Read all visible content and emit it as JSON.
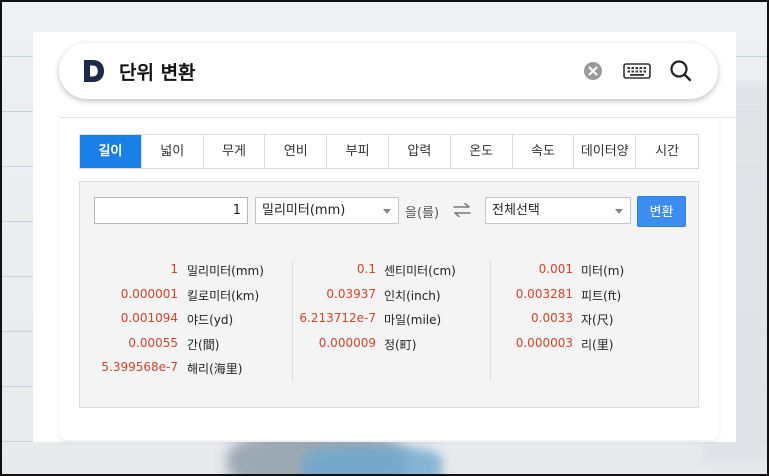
{
  "search": {
    "query": "단위 변환",
    "logo_letter": "D"
  },
  "tabs": [
    {
      "label": "길이",
      "active": true
    },
    {
      "label": "넓이",
      "active": false
    },
    {
      "label": "무게",
      "active": false
    },
    {
      "label": "연비",
      "active": false
    },
    {
      "label": "부피",
      "active": false
    },
    {
      "label": "압력",
      "active": false
    },
    {
      "label": "온도",
      "active": false
    },
    {
      "label": "속도",
      "active": false
    },
    {
      "label": "데이터양",
      "active": false
    },
    {
      "label": "시간",
      "active": false
    }
  ],
  "converter": {
    "input_value": "1",
    "from_unit": "밀리미터(mm)",
    "particle": "을(를)",
    "to_unit": "전체선택",
    "convert_label": "변환"
  },
  "results": {
    "col1": [
      {
        "value": "1",
        "unit": "밀리미터(mm)"
      },
      {
        "value": "0.000001",
        "unit": "킬로미터(km)"
      },
      {
        "value": "0.001094",
        "unit": "야드(yd)"
      },
      {
        "value": "0.00055",
        "unit": "간(間)"
      },
      {
        "value": "5.399568e-7",
        "unit": "해리(海里)"
      }
    ],
    "col2": [
      {
        "value": "0.1",
        "unit": "센티미터(cm)"
      },
      {
        "value": "0.03937",
        "unit": "인치(inch)"
      },
      {
        "value": "6.213712e-7",
        "unit": "마일(mile)"
      },
      {
        "value": "0.000009",
        "unit": "정(町)"
      }
    ],
    "col3": [
      {
        "value": "0.001",
        "unit": "미터(m)"
      },
      {
        "value": "0.003281",
        "unit": "피트(ft)"
      },
      {
        "value": "0.0033",
        "unit": "자(尺)"
      },
      {
        "value": "0.000003",
        "unit": "리(里)"
      }
    ]
  },
  "colors": {
    "accent": "#1a7fe6",
    "button": "#3b8ef0",
    "result_value": "#d0442c",
    "logo": "#1d2b48"
  }
}
